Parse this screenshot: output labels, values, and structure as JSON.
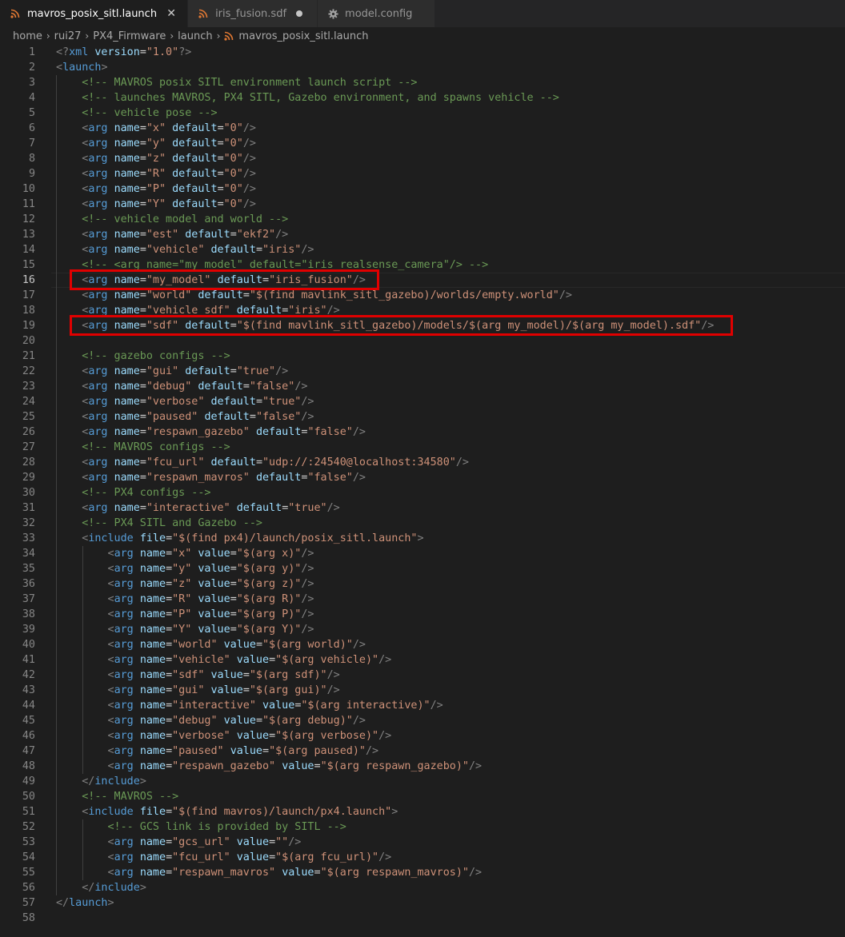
{
  "tabs": [
    {
      "label": "mavros_posix_sitl.launch",
      "icon": "rss-icon",
      "active": true,
      "closable": true
    },
    {
      "label": "iris_fusion.sdf",
      "icon": "rss-icon",
      "active": false,
      "dirty": true
    },
    {
      "label": "model.config",
      "icon": "gear-icon",
      "active": false
    }
  ],
  "breadcrumb": [
    "home",
    "rui27",
    "PX4_Firmware",
    "launch",
    "mavros_posix_sitl.launch"
  ],
  "colors": {
    "tag": "#569cd6",
    "attr": "#9cdcfe",
    "string": "#ce9178",
    "comment": "#6a9955",
    "punctuation": "#808080",
    "highlight_box": "#e00000",
    "file_icon": "#e37933"
  },
  "editor": {
    "current_line": 16,
    "highlighted_lines": [
      16,
      19
    ],
    "lines": [
      "<?xml version=\"1.0\"?>",
      "<launch>",
      "    <!-- MAVROS posix SITL environment launch script -->",
      "    <!-- launches MAVROS, PX4 SITL, Gazebo environment, and spawns vehicle -->",
      "    <!-- vehicle pose -->",
      "    <arg name=\"x\" default=\"0\"/>",
      "    <arg name=\"y\" default=\"0\"/>",
      "    <arg name=\"z\" default=\"0\"/>",
      "    <arg name=\"R\" default=\"0\"/>",
      "    <arg name=\"P\" default=\"0\"/>",
      "    <arg name=\"Y\" default=\"0\"/>",
      "    <!-- vehicle model and world -->",
      "    <arg name=\"est\" default=\"ekf2\"/>",
      "    <arg name=\"vehicle\" default=\"iris\"/>",
      "    <!-- <arg name=\"my_model\" default=\"iris_realsense_camera\"/> -->",
      "    <arg name=\"my_model\" default=\"iris_fusion\"/>",
      "    <arg name=\"world\" default=\"$(find mavlink_sitl_gazebo)/worlds/empty.world\"/>",
      "    <arg name=\"vehicle_sdf\" default=\"iris\"/>",
      "    <arg name=\"sdf\" default=\"$(find mavlink_sitl_gazebo)/models/$(arg my_model)/$(arg my_model).sdf\"/>",
      "",
      "    <!-- gazebo configs -->",
      "    <arg name=\"gui\" default=\"true\"/>",
      "    <arg name=\"debug\" default=\"false\"/>",
      "    <arg name=\"verbose\" default=\"true\"/>",
      "    <arg name=\"paused\" default=\"false\"/>",
      "    <arg name=\"respawn_gazebo\" default=\"false\"/>",
      "    <!-- MAVROS configs -->",
      "    <arg name=\"fcu_url\" default=\"udp://:24540@localhost:34580\"/>",
      "    <arg name=\"respawn_mavros\" default=\"false\"/>",
      "    <!-- PX4 configs -->",
      "    <arg name=\"interactive\" default=\"true\"/>",
      "    <!-- PX4 SITL and Gazebo -->",
      "    <include file=\"$(find px4)/launch/posix_sitl.launch\">",
      "        <arg name=\"x\" value=\"$(arg x)\"/>",
      "        <arg name=\"y\" value=\"$(arg y)\"/>",
      "        <arg name=\"z\" value=\"$(arg z)\"/>",
      "        <arg name=\"R\" value=\"$(arg R)\"/>",
      "        <arg name=\"P\" value=\"$(arg P)\"/>",
      "        <arg name=\"Y\" value=\"$(arg Y)\"/>",
      "        <arg name=\"world\" value=\"$(arg world)\"/>",
      "        <arg name=\"vehicle\" value=\"$(arg vehicle)\"/>",
      "        <arg name=\"sdf\" value=\"$(arg sdf)\"/>",
      "        <arg name=\"gui\" value=\"$(arg gui)\"/>",
      "        <arg name=\"interactive\" value=\"$(arg interactive)\"/>",
      "        <arg name=\"debug\" value=\"$(arg debug)\"/>",
      "        <arg name=\"verbose\" value=\"$(arg verbose)\"/>",
      "        <arg name=\"paused\" value=\"$(arg paused)\"/>",
      "        <arg name=\"respawn_gazebo\" value=\"$(arg respawn_gazebo)\"/>",
      "    </include>",
      "    <!-- MAVROS -->",
      "    <include file=\"$(find mavros)/launch/px4.launch\">",
      "        <!-- GCS link is provided by SITL -->",
      "        <arg name=\"gcs_url\" value=\"\"/>",
      "        <arg name=\"fcu_url\" value=\"$(arg fcu_url)\"/>",
      "        <arg name=\"respawn_mavros\" value=\"$(arg respawn_mavros)\"/>",
      "    </include>",
      "</launch>",
      ""
    ]
  }
}
